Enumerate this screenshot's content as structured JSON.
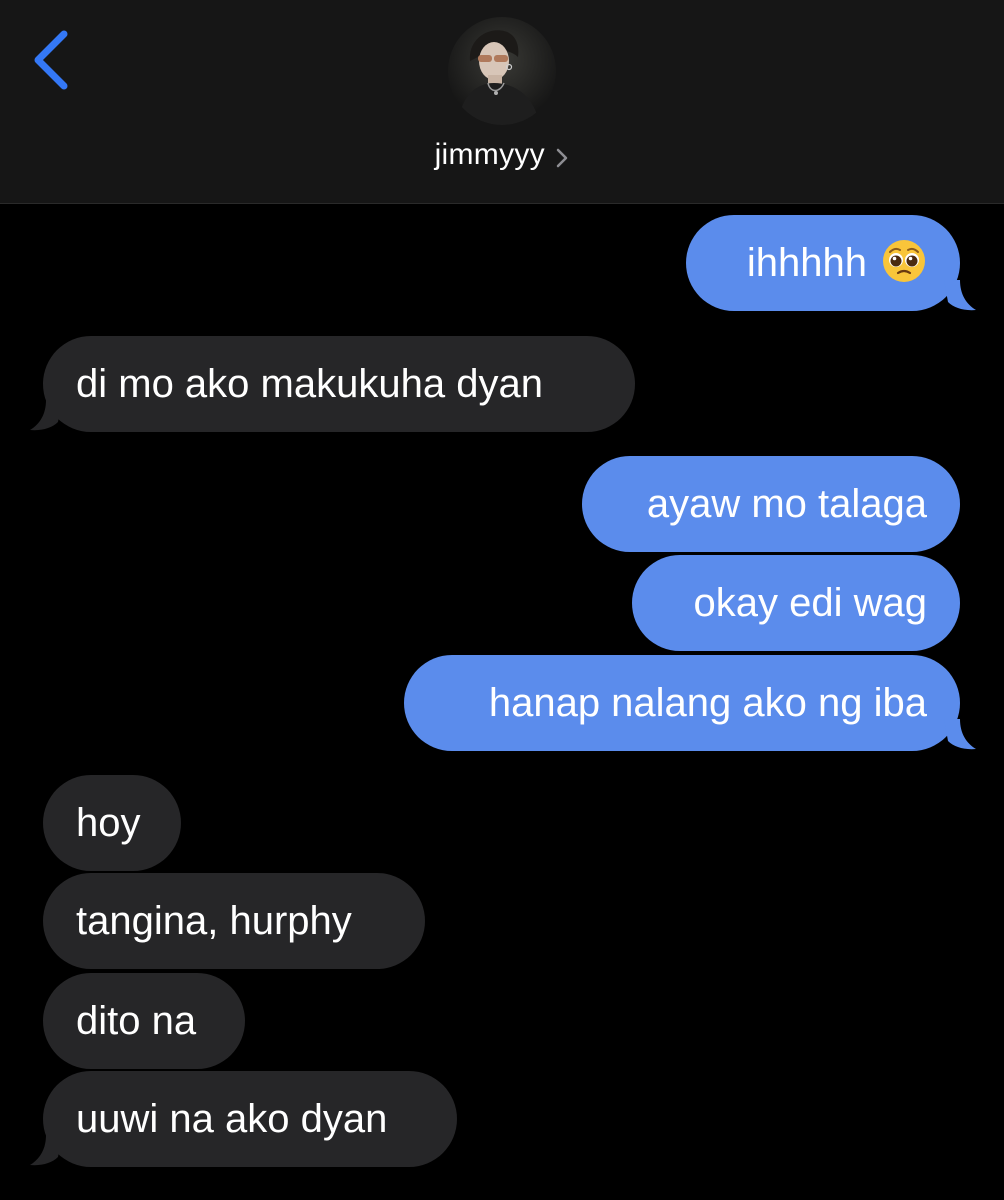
{
  "header": {
    "contact_name": "jimmyyy",
    "back_icon": "chevron-left-icon",
    "name_chevron_icon": "chevron-right-icon",
    "accent_color": "#3478f6"
  },
  "messages": [
    {
      "direction": "outgoing",
      "text": "ihhhhh",
      "emoji": "pleading-face-emoji"
    },
    {
      "direction": "incoming",
      "text": "di mo ako makukuha dyan"
    },
    {
      "direction": "outgoing",
      "text": "ayaw mo talaga"
    },
    {
      "direction": "outgoing",
      "text": "okay edi wag"
    },
    {
      "direction": "outgoing",
      "text": "hanap nalang ako ng iba"
    },
    {
      "direction": "incoming",
      "text": "hoy"
    },
    {
      "direction": "incoming",
      "text": "tangina, hurphy"
    },
    {
      "direction": "incoming",
      "text": "dito na"
    },
    {
      "direction": "incoming",
      "text": "uuwi na ako dyan"
    }
  ],
  "colors": {
    "outgoing_bubble": "#5b8cec",
    "incoming_bubble": "#262628",
    "header_bg": "#161616",
    "background": "#000000"
  }
}
